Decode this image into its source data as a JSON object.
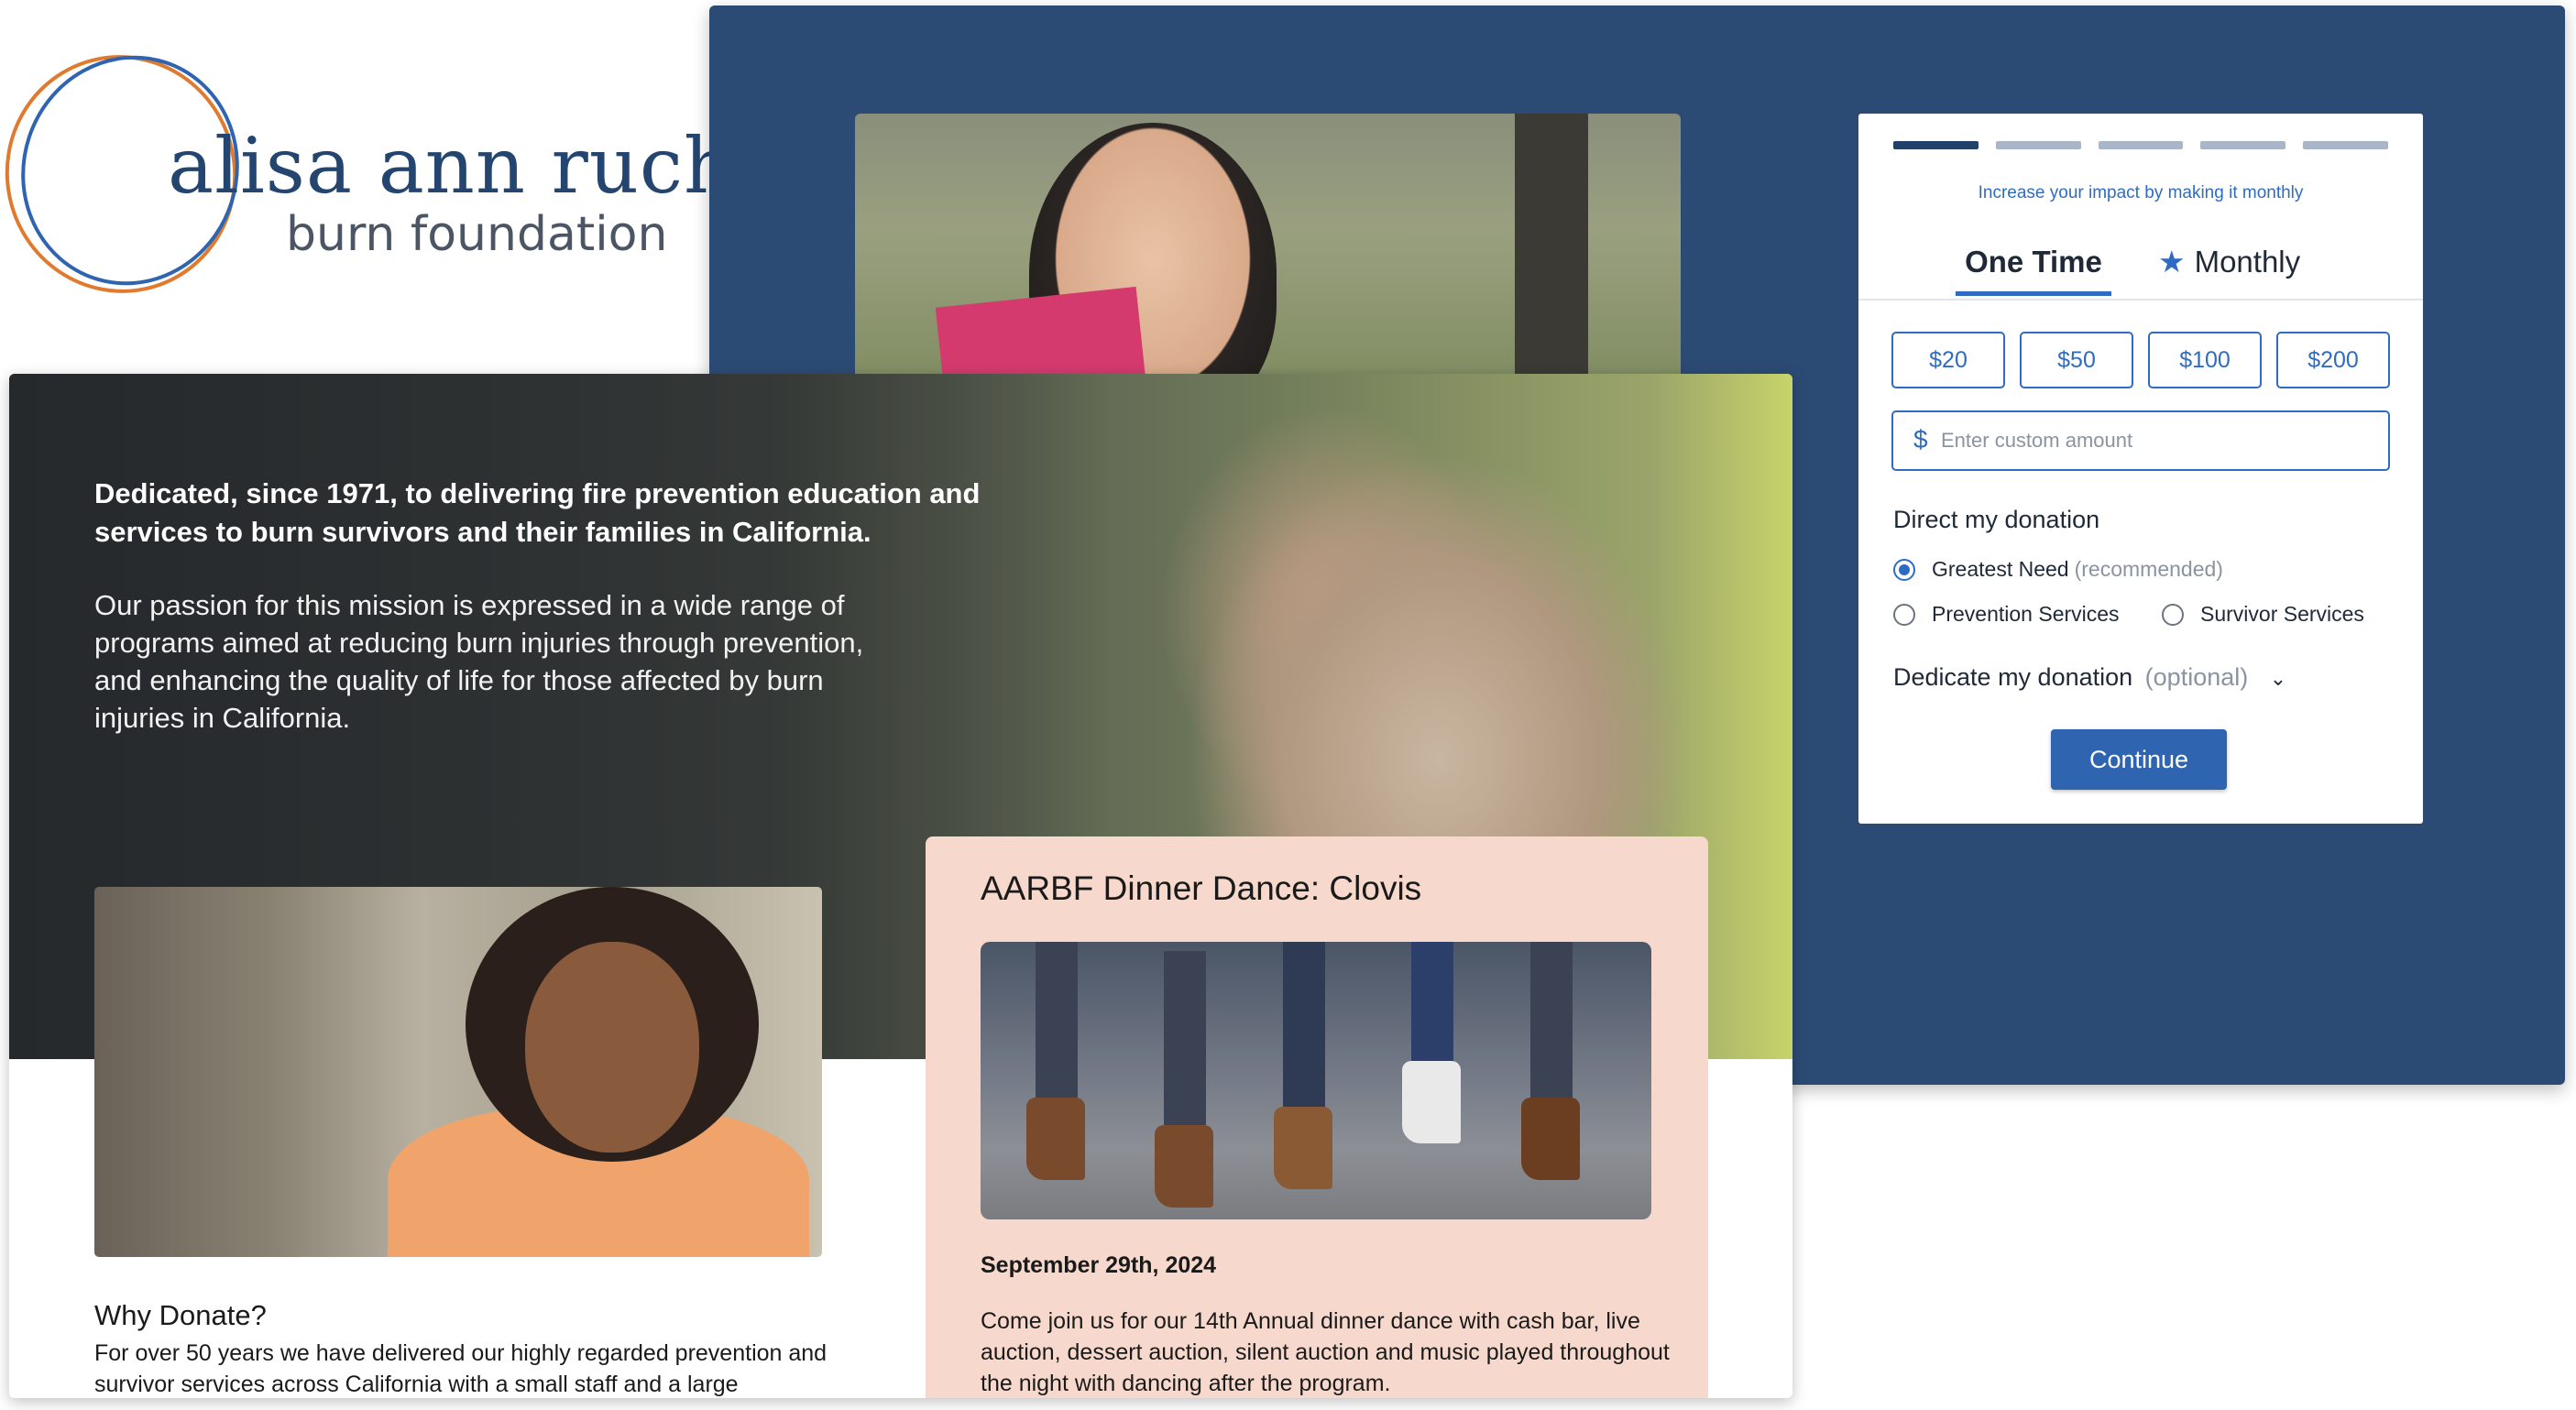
{
  "logo": {
    "line1": "alisa ann ruch",
    "line2": "burn foundation",
    "colors": {
      "ring_orange": "#e07a2e",
      "ring_blue": "#2f64b0",
      "text": "#24456f"
    }
  },
  "donation_form": {
    "upsell_text": "Increase your impact by making it monthly",
    "frequency_tabs": {
      "one_time": "One Time",
      "monthly": "Monthly",
      "active": "One Time"
    },
    "amounts": [
      "$20",
      "$50",
      "$100",
      "$200"
    ],
    "custom_amount": {
      "currency_symbol": "$",
      "placeholder": "Enter custom amount",
      "value": ""
    },
    "direct_title": "Direct my donation",
    "designations": [
      {
        "label": "Greatest Need",
        "note": "(recommended)",
        "selected": true
      },
      {
        "label": "Prevention Services",
        "note": "",
        "selected": false
      },
      {
        "label": "Survivor Services",
        "note": "",
        "selected": false
      }
    ],
    "dedicate_label": "Dedicate my donation",
    "dedicate_note": "(optional)",
    "continue_label": "Continue",
    "colors": {
      "accent": "#2f64b0",
      "panel": "#2c4b74"
    }
  },
  "hero": {
    "lead": "Dedicated, since 1971, to delivering fire prevention education and services to burn survivors and their families in California.",
    "body": "Our passion for this mission is expressed in a wide range of programs aimed at reducing burn injuries through prevention, and enhancing the quality of life for those affected by burn injuries in California."
  },
  "why_donate": {
    "title": "Why Donate?",
    "body": "For over 50 years we have delivered our highly regarded prevention and survivor services across California with a small staff and a large"
  },
  "event": {
    "title": "AARBF Dinner Dance: Clovis",
    "date": "September 29th, 2024",
    "body": "Come join us for our 14th Annual dinner dance with cash bar, live auction, dessert auction, silent auction and music played throughout the night with dancing after the program.",
    "colors": {
      "card_bg": "#f6d9cc"
    }
  }
}
